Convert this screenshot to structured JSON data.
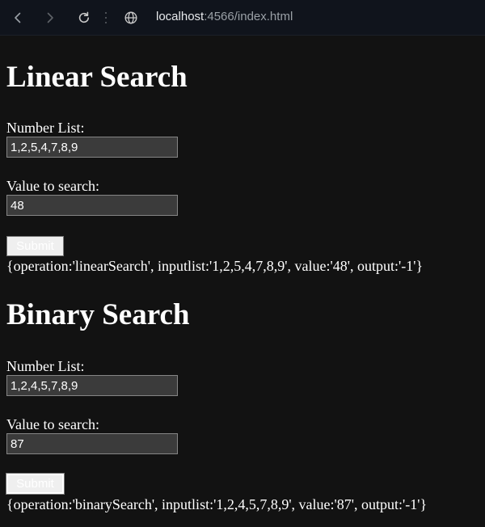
{
  "browser": {
    "url_host": "localhost",
    "url_rest": ":4566/index.html",
    "icons": [
      "back-arrow-icon",
      "forward-arrow-icon",
      "reload-icon",
      "site-info-icon"
    ]
  },
  "linear": {
    "title": "Linear Search",
    "list_label": "Number List:",
    "list_value": "1,2,5,4,7,8,9",
    "value_label": "Value to search:",
    "value_value": "48",
    "submit_label": "Submit",
    "result": "{operation:'linearSearch', inputlist:'1,2,5,4,7,8,9', value:'48', output:'-1'}"
  },
  "binary": {
    "title": "Binary Search",
    "list_label": "Number List:",
    "list_value": "1,2,4,5,7,8,9",
    "value_label": "Value to search:",
    "value_value": "87",
    "submit_label": "Submit",
    "result": "{operation:'binarySearch', inputlist:'1,2,4,5,7,8,9', value:'87', output:'-1'}"
  },
  "colors": {
    "page_background": "#121212",
    "browser_bar": "#10141c",
    "input_background": "#3b3b3b",
    "button_background": "#efefef"
  }
}
